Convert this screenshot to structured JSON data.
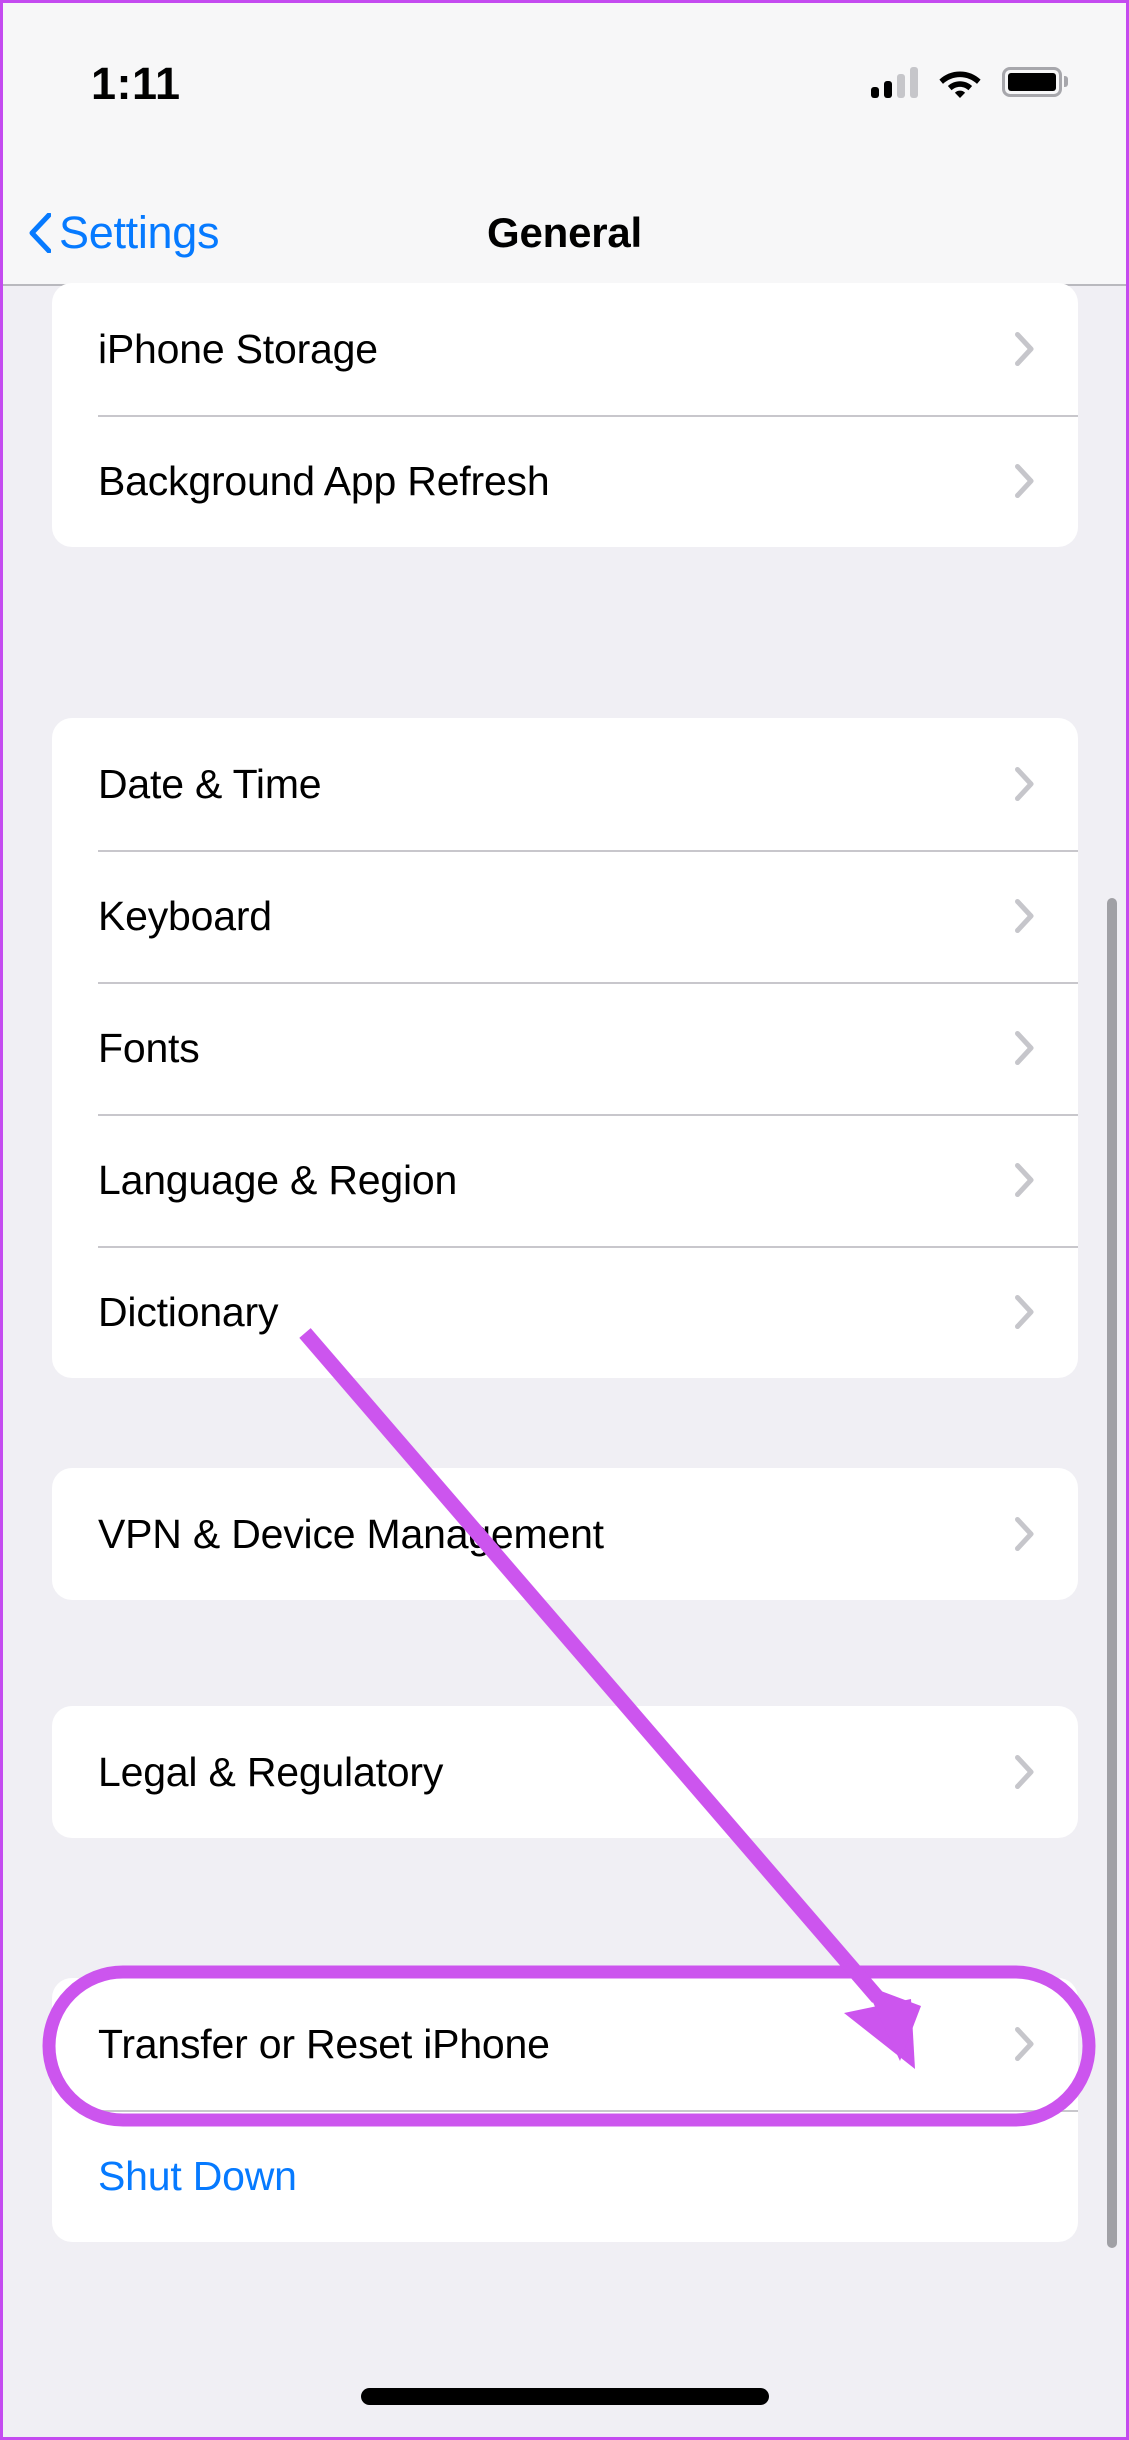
{
  "theme": {
    "accent_blue": "#067aff",
    "page_background": "#f0eff4",
    "card_background": "#ffffff",
    "bar_background": "#f7f7f8",
    "separator": "#c8c7cc",
    "chevron_gray": "#c6c6cb",
    "annotation_magenta": "#cc55ee",
    "frame_border": "#c44bf0"
  },
  "status_bar": {
    "time": "1:11",
    "icons": {
      "cellular": "cellular-signal-icon",
      "cellular_bars_filled": 2,
      "cellular_bars_total": 4,
      "wifi": "wifi-icon",
      "battery": "battery-icon"
    }
  },
  "nav_bar": {
    "back_icon": "chevron-left-icon",
    "back_label": "Settings",
    "title": "General"
  },
  "groups": [
    {
      "id": "group-storage",
      "rows": [
        {
          "label": "iPhone Storage",
          "accessory": "chevron-right-icon",
          "style": "default"
        },
        {
          "label": "Background App Refresh",
          "accessory": "chevron-right-icon",
          "style": "default"
        }
      ]
    },
    {
      "id": "group-localization",
      "rows": [
        {
          "label": "Date & Time",
          "accessory": "chevron-right-icon",
          "style": "default"
        },
        {
          "label": "Keyboard",
          "accessory": "chevron-right-icon",
          "style": "default"
        },
        {
          "label": "Fonts",
          "accessory": "chevron-right-icon",
          "style": "default"
        },
        {
          "label": "Language & Region",
          "accessory": "chevron-right-icon",
          "style": "default"
        },
        {
          "label": "Dictionary",
          "accessory": "chevron-right-icon",
          "style": "default"
        }
      ]
    },
    {
      "id": "group-vpn",
      "rows": [
        {
          "label": "VPN & Device Management",
          "accessory": "chevron-right-icon",
          "style": "default"
        }
      ]
    },
    {
      "id": "group-legal",
      "rows": [
        {
          "label": "Legal & Regulatory",
          "accessory": "chevron-right-icon",
          "style": "default"
        }
      ]
    },
    {
      "id": "group-reset",
      "rows": [
        {
          "label": "Transfer or Reset iPhone",
          "accessory": "chevron-right-icon",
          "style": "default"
        },
        {
          "label": "Shut Down",
          "accessory": "none",
          "style": "link"
        }
      ]
    }
  ],
  "annotations": {
    "highlight_target": "Transfer or Reset iPhone",
    "highlight_shape": "rounded-rectangle",
    "arrow": "down-right-arrow",
    "color": "#cc55ee"
  },
  "home_indicator": "home-indicator-bar"
}
